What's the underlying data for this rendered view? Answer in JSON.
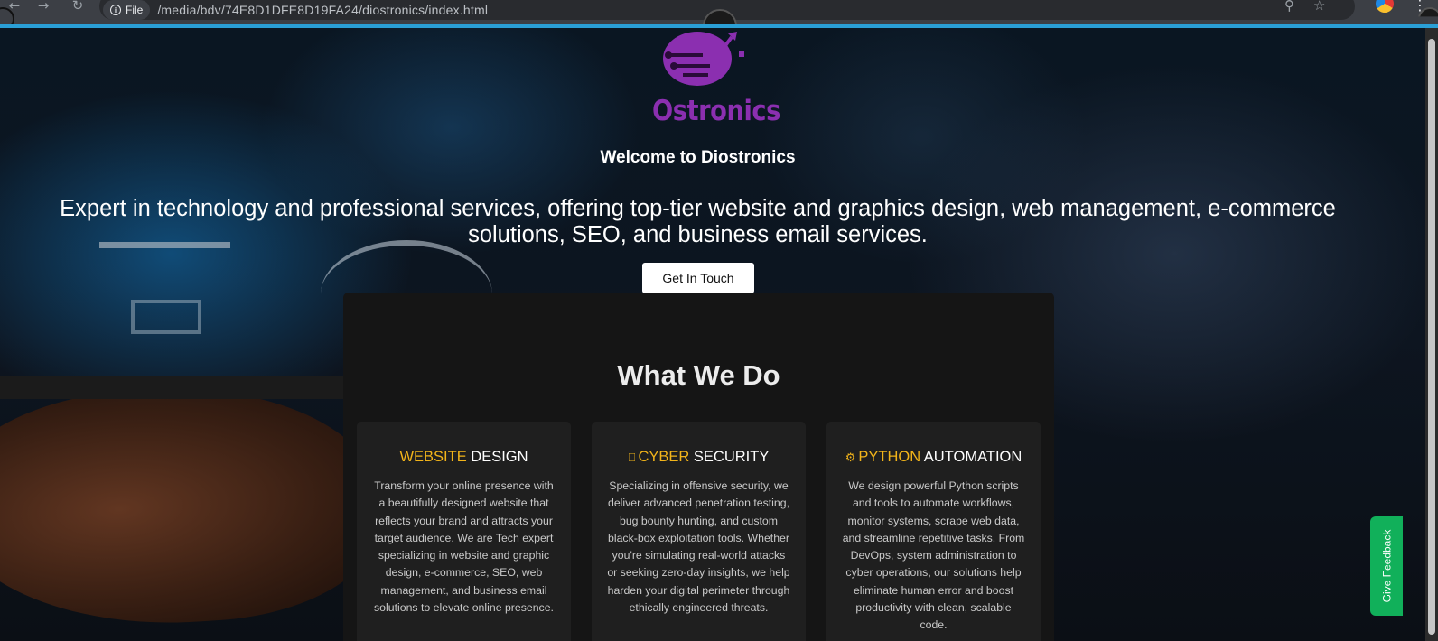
{
  "browser": {
    "file_label": "File",
    "url": "/media/bdv/74E8D1DFE8D19FA24/diostronics/index.html",
    "back_icon": "←",
    "forward_icon": "→",
    "reload_icon": "↻",
    "zoom_icon": "⚲",
    "star_icon": "☆",
    "menu_icon": "⋮"
  },
  "hero": {
    "logo_text": "Ostronics",
    "welcome": "Welcome to Diostronics",
    "tagline": "Expert in technology and professional services, offering top-tier website and graphics design, web management, e-commerce solutions, SEO, and business email services.",
    "cta_label": "Get In Touch"
  },
  "services": {
    "title": "What We Do",
    "cards": [
      {
        "icon": "",
        "accent": "WEBSITE",
        "rest": " DESIGN",
        "text": "Transform your online presence with a beautifully designed website that reflects your brand and attracts your target audience. We are Tech expert specializing in website and graphic design, e-commerce, SEO, web management, and business email solutions to elevate online presence."
      },
      {
        "icon": "⎕",
        "accent": "CYBER",
        "rest": " SECURITY",
        "text": "Specializing in offensive security, we deliver advanced penetration testing, bug bounty hunting, and custom black-box exploitation tools. Whether you're simulating real-world attacks or seeking zero-day insights, we help harden your digital perimeter through ethically engineered threats."
      },
      {
        "icon": "⚙",
        "accent": "PYTHON",
        "rest": " AUTOMATION",
        "text": "We design powerful Python scripts and tools to automate workflows, monitor systems, scrape web data, and streamline repetitive tasks. From DevOps, system administration to cyber operations, our solutions help eliminate human error and boost productivity with clean, scalable code."
      }
    ]
  },
  "feedback": {
    "label": "Give Feedback"
  },
  "colors": {
    "accent": "#f2b41a",
    "brand": "#8b2fb0",
    "feedback": "#11b05a",
    "loading": "#2a9fd6"
  }
}
